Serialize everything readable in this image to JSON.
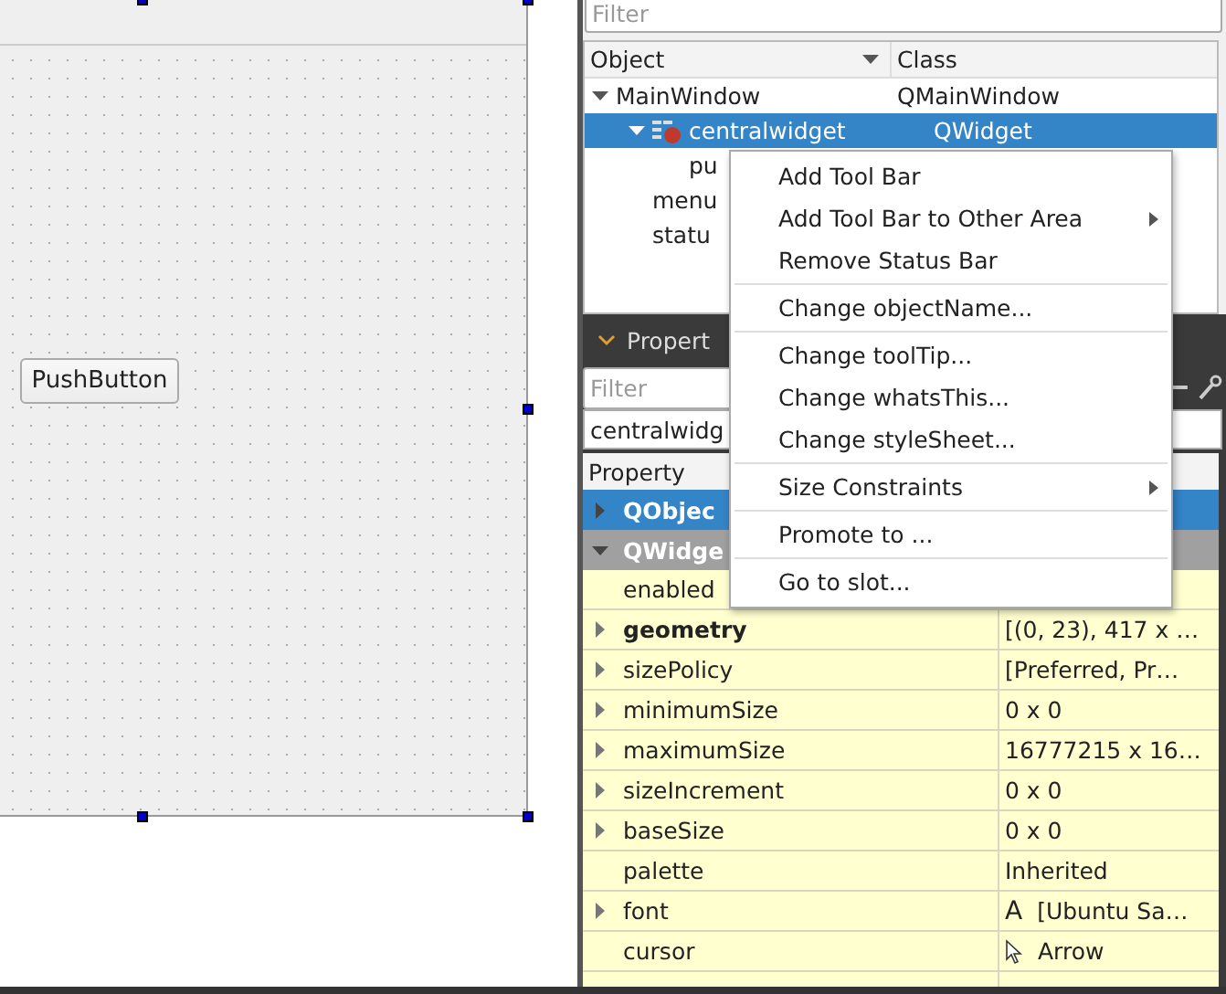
{
  "form": {
    "button_label": "PushButton"
  },
  "object_inspector": {
    "filter_placeholder": "Filter",
    "columns": [
      "Object",
      "Class"
    ],
    "tree": [
      {
        "name": "MainWindow",
        "class": "QMainWindow",
        "expanded": true,
        "selected": false,
        "children": [
          {
            "name": "centralwidget",
            "class": "QWidget",
            "expanded": true,
            "selected": true,
            "children": [
              {
                "name": "pu",
                "selected": false
              }
            ]
          },
          {
            "name": "menu",
            "selected": false
          },
          {
            "name": "statu",
            "selected": false
          }
        ]
      }
    ]
  },
  "property_editor": {
    "title": "Propert",
    "filter_placeholder": "Filter",
    "object": "centralwidg",
    "header": "Property",
    "rows": [
      {
        "kind": "class",
        "name": "QObjec",
        "expanded": false,
        "selected": true
      },
      {
        "kind": "class",
        "name": "QWidge",
        "expanded": true,
        "selected": false
      },
      {
        "kind": "property",
        "name": "enabled",
        "has_children": false,
        "changed": false
      },
      {
        "kind": "property",
        "name": "geometry",
        "value": "[(0, 23), 417 x …",
        "has_children": true,
        "changed": true
      },
      {
        "kind": "property",
        "name": "sizePolicy",
        "value": "[Preferred, Pr…",
        "has_children": true,
        "changed": false
      },
      {
        "kind": "property",
        "name": "minimumSize",
        "value": "0 x 0",
        "has_children": true,
        "changed": false
      },
      {
        "kind": "property",
        "name": "maximumSize",
        "value": "16777215 x 16…",
        "has_children": true,
        "changed": false
      },
      {
        "kind": "property",
        "name": "sizeIncrement",
        "value": "0 x 0",
        "has_children": true,
        "changed": false
      },
      {
        "kind": "property",
        "name": "baseSize",
        "value": "0 x 0",
        "has_children": true,
        "changed": false
      },
      {
        "kind": "property",
        "name": "palette",
        "value": "Inherited",
        "has_children": false,
        "changed": false
      },
      {
        "kind": "property",
        "name": "font",
        "value": {
          "kind": "font",
          "glyph": "A",
          "text": "[Ubuntu Sa…"
        },
        "has_children": true,
        "changed": false
      },
      {
        "kind": "property",
        "name": "cursor",
        "value": {
          "kind": "cursor",
          "text": "Arrow"
        },
        "has_children": false,
        "changed": false
      }
    ]
  },
  "context_menu": {
    "items": [
      {
        "kind": "item",
        "label": "Add Tool Bar",
        "submenu": false
      },
      {
        "kind": "item",
        "label": "Add Tool Bar to Other Area",
        "submenu": true
      },
      {
        "kind": "item",
        "label": "Remove Status Bar",
        "submenu": false
      },
      {
        "kind": "separator"
      },
      {
        "kind": "item",
        "label": "Change objectName...",
        "submenu": false
      },
      {
        "kind": "separator"
      },
      {
        "kind": "item",
        "label": "Change toolTip...",
        "submenu": false
      },
      {
        "kind": "item",
        "label": "Change whatsThis...",
        "submenu": false
      },
      {
        "kind": "item",
        "label": "Change styleSheet...",
        "submenu": false
      },
      {
        "kind": "separator"
      },
      {
        "kind": "item",
        "label": "Size Constraints",
        "submenu": true
      },
      {
        "kind": "separator"
      },
      {
        "kind": "item",
        "label": "Promote to ...",
        "submenu": false
      },
      {
        "kind": "separator"
      },
      {
        "kind": "item",
        "label": "Go to slot...",
        "submenu": false
      }
    ]
  }
}
